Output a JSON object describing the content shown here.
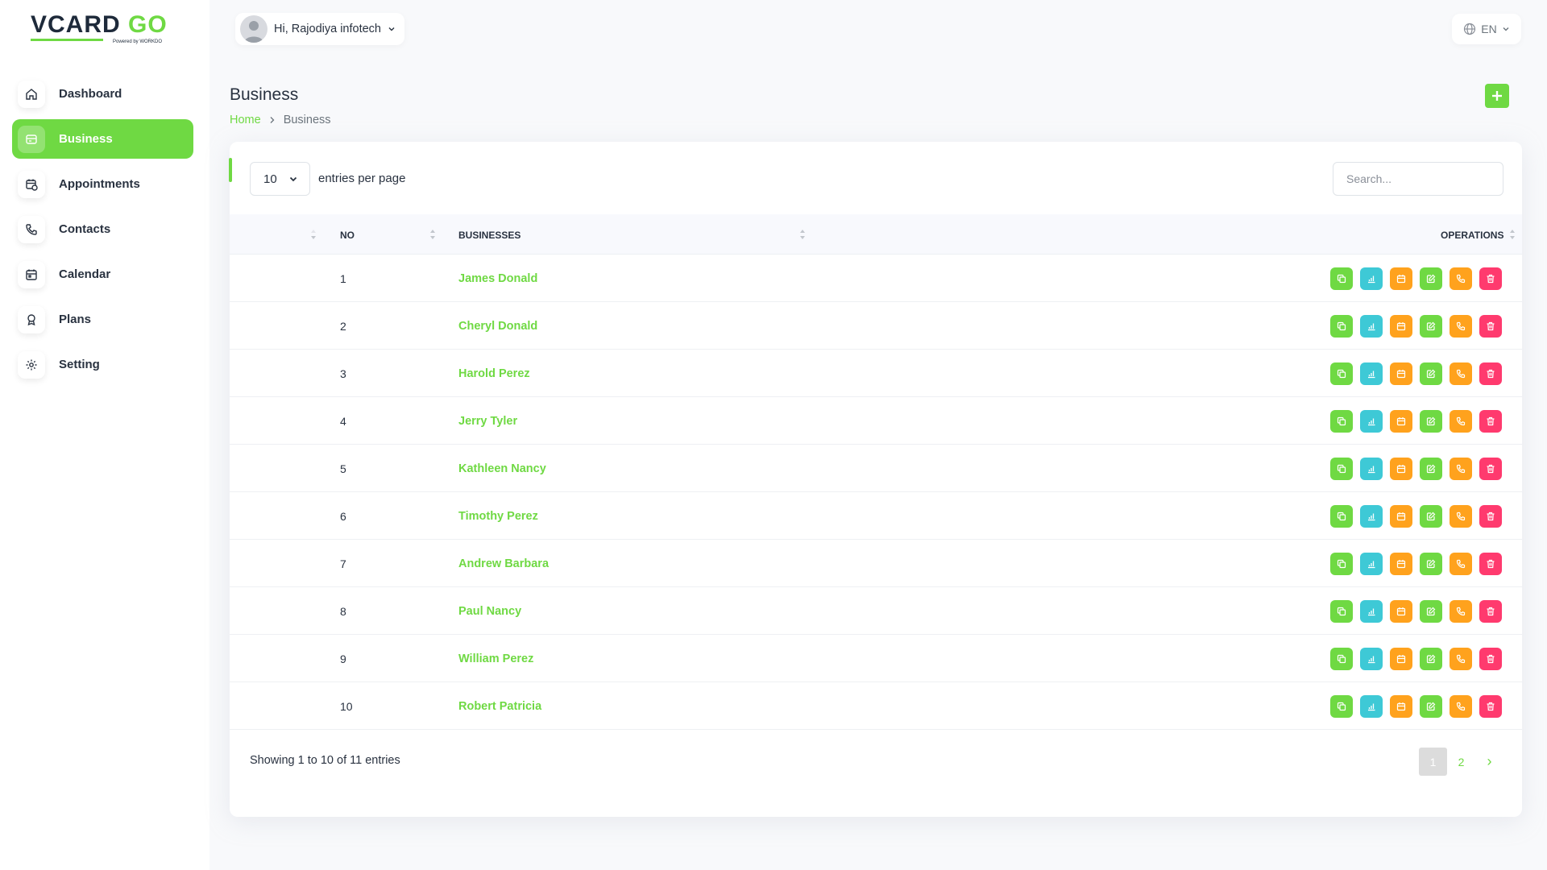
{
  "brand": {
    "logo_text": "VCARDGO",
    "logo_tagline": "Powered by WORKDO",
    "accent_color": "#6fd943"
  },
  "sidebar": {
    "items": [
      {
        "label": "Dashboard",
        "icon": "home-icon",
        "active": false
      },
      {
        "label": "Business",
        "icon": "business-icon",
        "active": true
      },
      {
        "label": "Appointments",
        "icon": "calendar-clock-icon",
        "active": false
      },
      {
        "label": "Contacts",
        "icon": "phone-icon",
        "active": false
      },
      {
        "label": "Calendar",
        "icon": "calendar-icon",
        "active": false
      },
      {
        "label": "Plans",
        "icon": "award-icon",
        "active": false
      },
      {
        "label": "Setting",
        "icon": "gear-icon",
        "active": false
      }
    ]
  },
  "header": {
    "greeting": "Hi, Rajodiya infotech",
    "language": "EN"
  },
  "page": {
    "title": "Business",
    "breadcrumb_home": "Home",
    "breadcrumb_current": "Business"
  },
  "table": {
    "per_page_value": "10",
    "per_page_label": "entries per page",
    "search_placeholder": "Search...",
    "columns": {
      "no": "NO",
      "businesses": "BUSINESSES",
      "operations": "OPERATIONS"
    },
    "rows": [
      {
        "no": "1",
        "name": "James Donald"
      },
      {
        "no": "2",
        "name": "Cheryl Donald"
      },
      {
        "no": "3",
        "name": "Harold Perez"
      },
      {
        "no": "4",
        "name": "Jerry Tyler"
      },
      {
        "no": "5",
        "name": "Kathleen Nancy"
      },
      {
        "no": "6",
        "name": "Timothy Perez"
      },
      {
        "no": "7",
        "name": "Andrew Barbara"
      },
      {
        "no": "8",
        "name": "Paul Nancy"
      },
      {
        "no": "9",
        "name": "William Perez"
      },
      {
        "no": "10",
        "name": "Robert Patricia"
      }
    ],
    "operations": [
      {
        "name": "duplicate",
        "icon": "copy-icon",
        "color": "#6fd943"
      },
      {
        "name": "analytics",
        "icon": "chart-icon",
        "color": "#3ec9d6"
      },
      {
        "name": "appointments",
        "icon": "calendar-icon",
        "color": "#ffa21d"
      },
      {
        "name": "edit",
        "icon": "edit-icon",
        "color": "#6fd943"
      },
      {
        "name": "contacts",
        "icon": "phone-icon",
        "color": "#ffa21d"
      },
      {
        "name": "delete",
        "icon": "trash-icon",
        "color": "#ff3a6e"
      }
    ],
    "showing_text": "Showing 1 to 10 of 11 entries",
    "pages": [
      "1",
      "2"
    ],
    "current_page": "1",
    "next_label": "›"
  }
}
